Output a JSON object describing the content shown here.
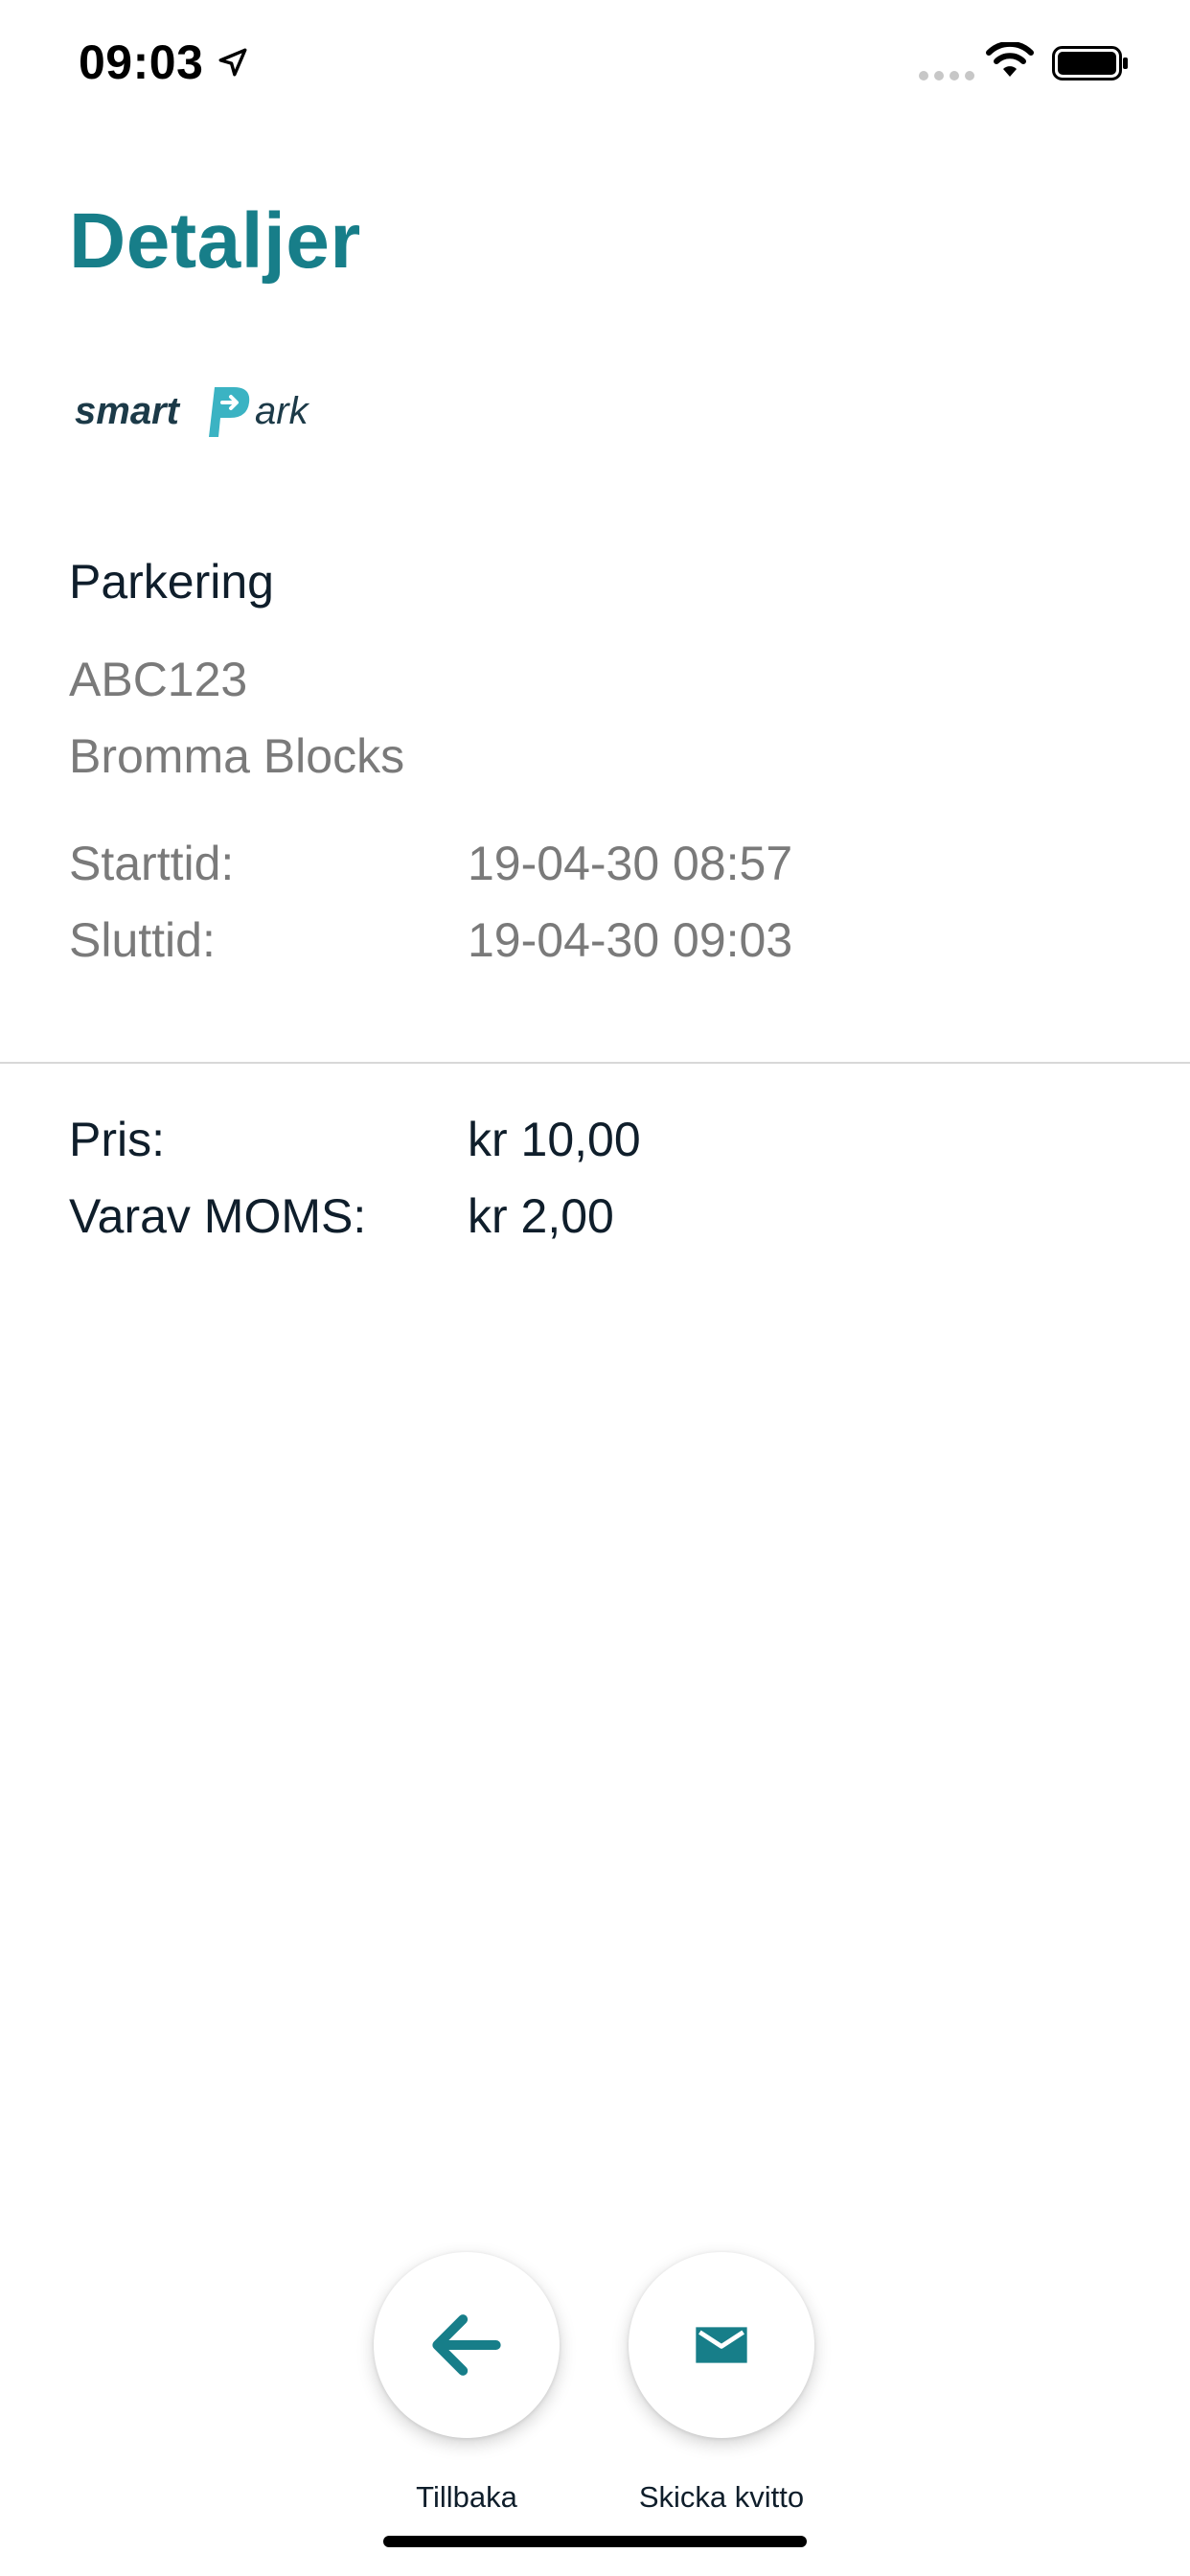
{
  "status_bar": {
    "time": "09:03",
    "icons": [
      "location-arrow-icon",
      "signal-dots-icon",
      "wifi-icon",
      "battery-icon"
    ]
  },
  "page": {
    "title": "Detaljer"
  },
  "logo": {
    "text_left": "smart",
    "text_right": "ark",
    "colors": {
      "text": "#1c3a48",
      "mark": "#3bb3c3"
    }
  },
  "details": {
    "section_title": "Parkering",
    "plate": "ABC123",
    "location": "Bromma Blocks",
    "start_label": "Starttid:",
    "start_value": "19-04-30 08:57",
    "end_label": "Sluttid:",
    "end_value": "19-04-30 09:03"
  },
  "pricing": {
    "price_label": "Pris:",
    "price_value": "kr 10,00",
    "vat_label": "Varav MOMS:",
    "vat_value": "kr 2,00"
  },
  "actions": {
    "back_label": "Tillbaka",
    "back_icon": "arrow-left-icon",
    "send_label": "Skicka kvitto",
    "send_icon": "envelope-icon"
  },
  "colors": {
    "accent": "#177e89",
    "text_dark": "#0f1e2b",
    "text_gray": "#7a7a7a",
    "divider": "#d8d8d8"
  }
}
